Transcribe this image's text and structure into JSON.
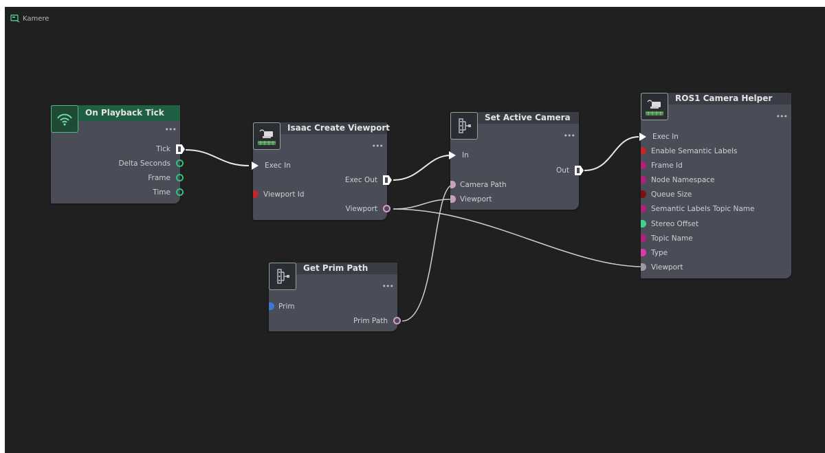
{
  "graph": {
    "title": "Kamere"
  },
  "nodes": {
    "on_playback_tick": {
      "title": "On Playback Tick",
      "menu": "•••",
      "outputs": [
        "Tick",
        "Delta Seconds",
        "Frame",
        "Time"
      ]
    },
    "isaac_create_viewport": {
      "title": "Isaac Create Viewport",
      "menu": "•••",
      "inputs": [
        "Exec In",
        "Viewport Id"
      ],
      "outputs": [
        "Exec Out",
        "Viewport"
      ]
    },
    "set_active_camera": {
      "title": "Set Active Camera",
      "menu": "•••",
      "inputs": [
        "In",
        "Camera Path",
        "Viewport"
      ],
      "outputs": [
        "Out"
      ]
    },
    "get_prim_path": {
      "title": "Get Prim Path",
      "menu": "•••",
      "inputs": [
        "Prim"
      ],
      "outputs": [
        "Prim Path"
      ]
    },
    "ros1_camera_helper": {
      "title": "ROS1 Camera Helper",
      "menu": "•••",
      "inputs": [
        "Exec In",
        "Enable Semantic Labels",
        "Frame Id",
        "Node Namespace",
        "Queue Size",
        "Semantic Labels Topic Name",
        "Stereo Offset",
        "Topic Name",
        "Type",
        "Viewport"
      ]
    }
  },
  "colors": {
    "canvas": "#202020",
    "node_body": "#4a4d58",
    "node_header": "#3a3d45",
    "event_header": "#1f5f44",
    "pin_green": "#2ec27e",
    "pin_red": "#c0282d",
    "pin_dark_red": "#7a1010",
    "pin_magenta": "#b0207c",
    "pin_pink": "#c8a0c0",
    "pin_blue": "#3a78d6",
    "pin_mint": "#3ed48a",
    "pin_hot_pink": "#d83ca8",
    "pin_grey": "#9a9aa0",
    "wire": "#e0e0e0"
  },
  "icons": {
    "graph_tab": "graph-icon",
    "on_playback_tick": "broadcast-icon",
    "isaac_create_viewport": "camera-icon",
    "set_active_camera": "function-icon",
    "get_prim_path": "function-icon",
    "ros1_camera_helper": "camera-icon"
  }
}
